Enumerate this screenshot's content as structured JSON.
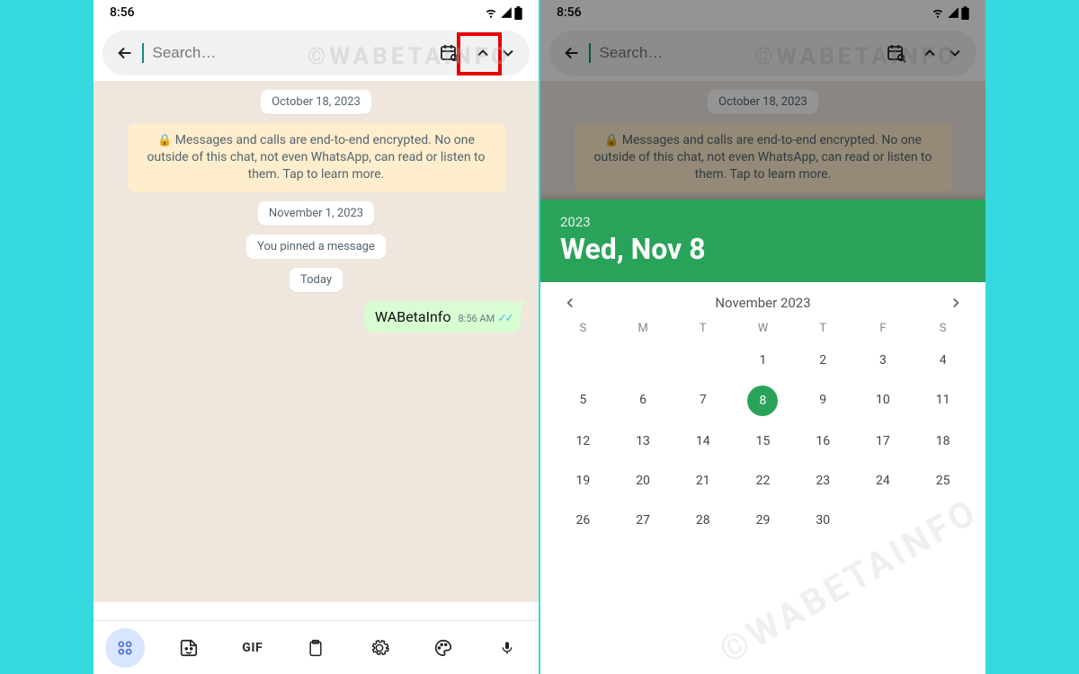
{
  "status": {
    "time": "8:56"
  },
  "search": {
    "placeholder": "Search…"
  },
  "watermark": "©WABETAINFO",
  "chat": {
    "date1": "October 18, 2023",
    "encryption_notice": "Messages and calls are end-to-end encrypted. No one outside of this chat, not even WhatsApp, can read or listen to them. Tap to learn more.",
    "date2": "November 1, 2023",
    "system_pinned": "You pinned a message",
    "date3": "Today",
    "message_text": "WABetaInfo",
    "message_time": "8:56 AM"
  },
  "toolbar": {
    "gif": "GIF"
  },
  "calendar": {
    "year": "2023",
    "selected_display": "Wed, Nov 8",
    "month_label": "November 2023",
    "dow": [
      "S",
      "M",
      "T",
      "W",
      "T",
      "F",
      "S"
    ],
    "lead_blanks": 3,
    "days": [
      1,
      2,
      3,
      4,
      5,
      6,
      7,
      8,
      9,
      10,
      11,
      12,
      13,
      14,
      15,
      16,
      17,
      18,
      19,
      20,
      21,
      22,
      23,
      24,
      25,
      26,
      27,
      28,
      29,
      30
    ],
    "selected_day": 8
  }
}
